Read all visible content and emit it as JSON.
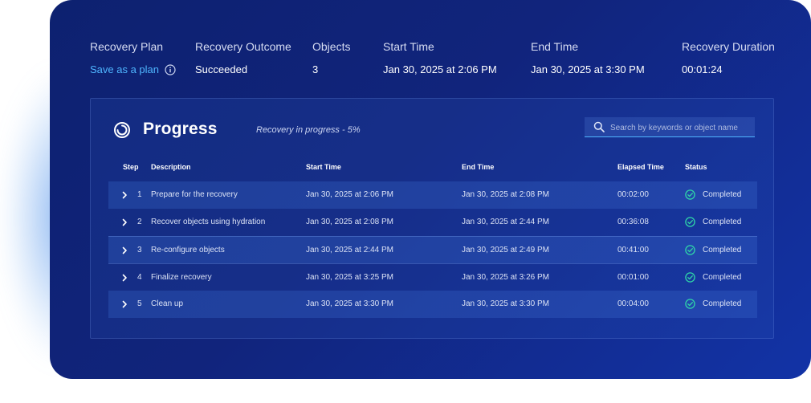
{
  "summary": [
    {
      "label": "Recovery Plan",
      "value": "Save as a plan",
      "is_link": true
    },
    {
      "label": "Recovery Outcome",
      "value": "Succeeded"
    },
    {
      "label": "Objects",
      "value": "3"
    },
    {
      "label": "Start Time",
      "value": "Jan 30, 2025 at 2:06 PM"
    },
    {
      "label": "End Time",
      "value": "Jan 30, 2025 at 3:30 PM"
    },
    {
      "label": "Recovery Duration",
      "value": "00:01:24"
    }
  ],
  "progress": {
    "title": "Progress",
    "subtitle": "Recovery in progress - 5%",
    "search_placeholder": "Search by keywords or object name"
  },
  "table": {
    "headers": {
      "step": "Step",
      "description": "Description",
      "start": "Start Time",
      "end": "End Time",
      "elapsed": "Elapsed Time",
      "status": "Status"
    },
    "rows": [
      {
        "step": "1",
        "description": "Prepare for the recovery",
        "start": "Jan 30, 2025 at 2:06 PM",
        "end": "Jan 30, 2025 at 2:08 PM",
        "elapsed": "00:02:00",
        "status": "Completed"
      },
      {
        "step": "2",
        "description": "Recover objects using hydration",
        "start": "Jan 30, 2025 at 2:08 PM",
        "end": "Jan 30, 2025 at 2:44 PM",
        "elapsed": "00:36:08",
        "status": "Completed"
      },
      {
        "step": "3",
        "description": "Re-configure objects",
        "start": "Jan 30, 2025 at 2:44 PM",
        "end": "Jan 30, 2025 at 2:49 PM",
        "elapsed": "00:41:00",
        "status": "Completed"
      },
      {
        "step": "4",
        "description": "Finalize recovery",
        "start": "Jan 30, 2025 at 3:25 PM",
        "end": "Jan 30, 2025 at 3:26 PM",
        "elapsed": "00:01:00",
        "status": "Completed"
      },
      {
        "step": "5",
        "description": "Clean up",
        "start": "Jan 30, 2025 at 3:30 PM",
        "end": "Jan 30, 2025 at 3:30 PM",
        "elapsed": "00:04:00",
        "status": "Completed"
      }
    ]
  },
  "icons": {
    "info": "info-circle-icon",
    "progress": "progress-ring-icon",
    "search": "search-icon",
    "expand": "chevron-right-icon",
    "status": "check-circle-icon"
  },
  "colors": {
    "accent": "#4fb6ff",
    "success": "#2fd6a8"
  }
}
